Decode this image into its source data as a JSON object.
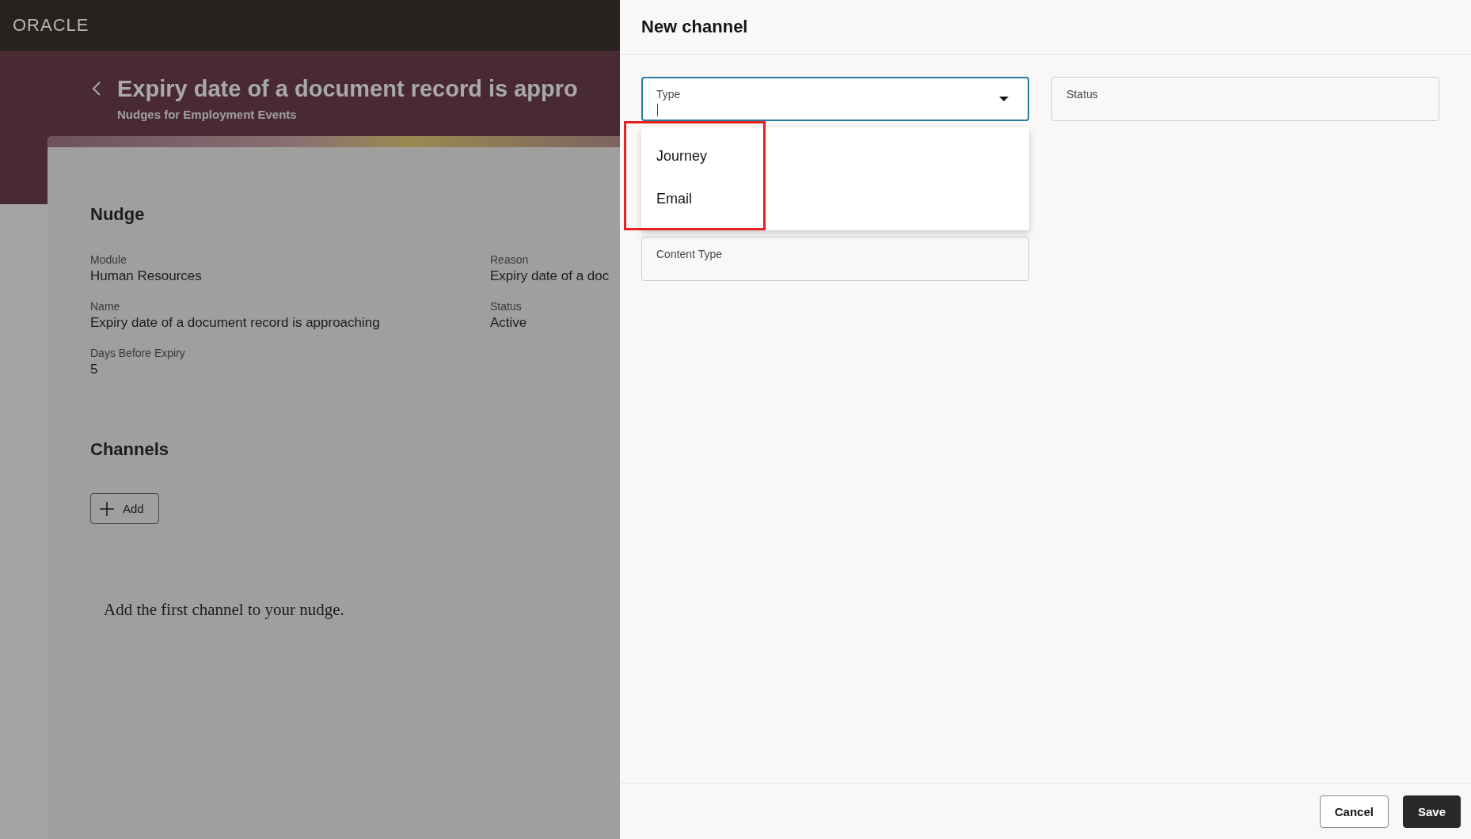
{
  "header": {
    "logo": "ORACLE"
  },
  "page": {
    "title": "Expiry date of a document record is appro",
    "subtitle": "Nudges for Employment Events"
  },
  "nudge": {
    "heading": "Nudge",
    "fields": [
      {
        "label": "Module",
        "value": "Human Resources"
      },
      {
        "label": "Reason",
        "value": "Expiry date of a doc"
      },
      {
        "label": "Name",
        "value": "Expiry date of a document record is approaching"
      },
      {
        "label": "Status",
        "value": "Active"
      },
      {
        "label": "Days Before Expiry",
        "value": "5"
      }
    ]
  },
  "channels": {
    "heading": "Channels",
    "add_button": "Add",
    "empty_message": "Add the first channel to your nudge."
  },
  "drawer": {
    "title": "New channel",
    "fields": [
      {
        "label": "Type",
        "kind": "select",
        "focused": true,
        "expanded": true,
        "options": [
          {
            "label": "Journey",
            "selected": false
          },
          {
            "label": "Email",
            "selected": false
          }
        ]
      },
      {
        "label": "Status",
        "kind": "text",
        "focused": false
      },
      {
        "label": "Content Type",
        "kind": "text",
        "focused": false
      }
    ],
    "buttons": [
      {
        "label": "Cancel",
        "kind": "secondary"
      },
      {
        "label": "Save",
        "kind": "primary"
      }
    ]
  }
}
